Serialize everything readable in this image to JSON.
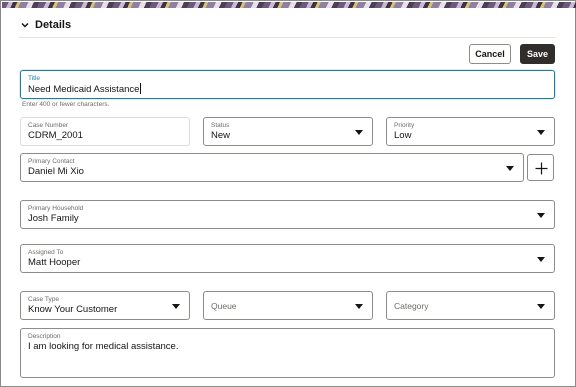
{
  "section": {
    "title": "Details",
    "icon": "chevron-down-icon"
  },
  "actions": {
    "cancel_label": "Cancel",
    "save_label": "Save"
  },
  "form": {
    "title": {
      "label": "Title",
      "value": "Need Medicaid Assistance",
      "help": "Enter 400 or fewer characters."
    },
    "case_number": {
      "label": "Case Number",
      "value": "CDRM_2001"
    },
    "status": {
      "label": "Status",
      "value": "New"
    },
    "priority": {
      "label": "Priority",
      "value": "Low"
    },
    "primary_contact": {
      "label": "Primary Contact",
      "value": "Daniel Mi Xio"
    },
    "primary_household": {
      "label": "Primary Household",
      "value": "Josh Family"
    },
    "assigned_to": {
      "label": "Assigned To",
      "value": "Matt Hooper"
    },
    "case_type": {
      "label": "Case Type",
      "value": "Know Your Customer"
    },
    "queue": {
      "placeholder": "Queue"
    },
    "category": {
      "placeholder": "Category"
    },
    "description": {
      "label": "Description",
      "value": "I am looking for medical assistance."
    }
  },
  "colors": {
    "accent": "#227e9e",
    "primary_button": "#312d2a",
    "border": "#8f8c88"
  }
}
